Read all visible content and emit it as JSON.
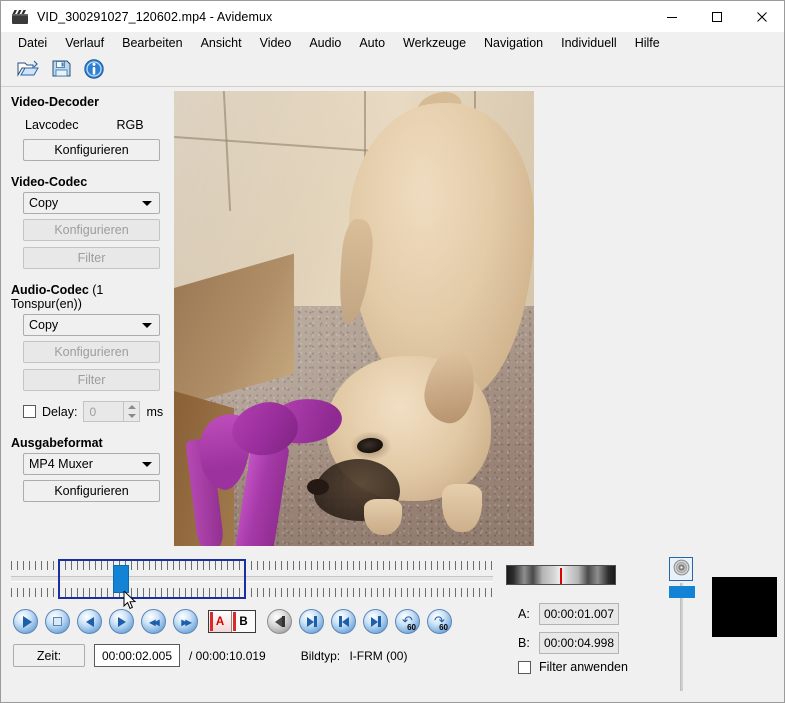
{
  "window": {
    "title": "VID_300291027_120602.mp4 - Avidemux",
    "icon": "film-clapper-icon",
    "minimize": "—",
    "maximize": "☐",
    "close": "✕"
  },
  "menubar": {
    "items": [
      {
        "label": "Datei"
      },
      {
        "label": "Verlauf"
      },
      {
        "label": "Bearbeiten"
      },
      {
        "label": "Ansicht"
      },
      {
        "label": "Video"
      },
      {
        "label": "Audio"
      },
      {
        "label": "Auto"
      },
      {
        "label": "Werkzeuge"
      },
      {
        "label": "Navigation"
      },
      {
        "label": "Individuell"
      },
      {
        "label": "Hilfe"
      }
    ]
  },
  "toolbar": {
    "buttons": [
      {
        "name": "open-file-icon",
        "tip": "Open"
      },
      {
        "name": "save-file-icon",
        "tip": "Save"
      },
      {
        "name": "info-icon",
        "tip": "Information"
      }
    ]
  },
  "left_panel": {
    "video_decoder": {
      "title": "Video-Decoder",
      "codec": "Lavcodec",
      "colorspace": "RGB",
      "configure_label": "Konfigurieren"
    },
    "video_codec": {
      "title": "Video-Codec",
      "selected": "Copy",
      "configure_label": "Konfigurieren",
      "filter_label": "Filter"
    },
    "audio_codec": {
      "title": "Audio-Codec",
      "title_sub": " (1 Tonspur(en))",
      "selected": "Copy",
      "configure_label": "Konfigurieren",
      "filter_label": "Filter",
      "delay_label": "Delay:",
      "delay_value": "0",
      "delay_unit": "ms",
      "delay_checked": false
    },
    "output_format": {
      "title": "Ausgabeformat",
      "selected": "MP4 Muxer",
      "configure_label": "Konfigurieren"
    }
  },
  "preview": {
    "name": "video-preview",
    "description": "French bulldog on carpet chewing a purple ribbon, beige tiled wall behind"
  },
  "timeline": {
    "selection_start_pct": 9.8,
    "selection_end_pct": 48.8,
    "playhead_pct": 21.2,
    "cursor_visible": true
  },
  "transport": {
    "buttons": [
      {
        "name": "play-button",
        "glyph": "play"
      },
      {
        "name": "stop-button",
        "glyph": "stop"
      },
      {
        "name": "previous-frame-button",
        "glyph": "arrow-left"
      },
      {
        "name": "next-frame-button",
        "glyph": "arrow-right"
      },
      {
        "name": "rewind-button",
        "glyph": "double-left"
      },
      {
        "name": "fast-forward-button",
        "glyph": "double-right"
      },
      {
        "name": "marker-a-button",
        "label": "A"
      },
      {
        "name": "marker-b-button",
        "label": "B"
      },
      {
        "name": "go-to-previous-blackframe-button",
        "glyph": "bar-left"
      },
      {
        "name": "go-to-next-keyframe-button",
        "glyph": "bar-right"
      },
      {
        "name": "go-to-start-button",
        "glyph": "skip-start"
      },
      {
        "name": "go-to-end-button",
        "glyph": "skip-end"
      },
      {
        "name": "back-60s-button",
        "glyph": "back-60",
        "badge": "60"
      },
      {
        "name": "forward-60s-button",
        "glyph": "fwd-60",
        "badge": "60"
      }
    ]
  },
  "status": {
    "zeit_label": "Zeit:",
    "current_time": "00:00:02.005",
    "total_time": "/ 00:00:10.019",
    "frametype_label": "Bildtyp:",
    "frametype_value": "I-FRM (00)"
  },
  "right_panel": {
    "shuttle_name": "shuttle-control",
    "marker_a_label": "A:",
    "marker_a_value": "00:00:01.007",
    "marker_b_label": "B:",
    "marker_b_value": "00:00:04.998",
    "filter_checkbox_label": "Filter anwenden",
    "filter_checked": false,
    "volume_icon": "speaker-icon",
    "volume_pct": 92
  },
  "colors": {
    "window_bg": "#f0f0f0",
    "accent_blue": "#1383d6",
    "selection_border": "#1a2fa0",
    "marker_red": "#d92b2b",
    "button_border": "#adadad"
  }
}
